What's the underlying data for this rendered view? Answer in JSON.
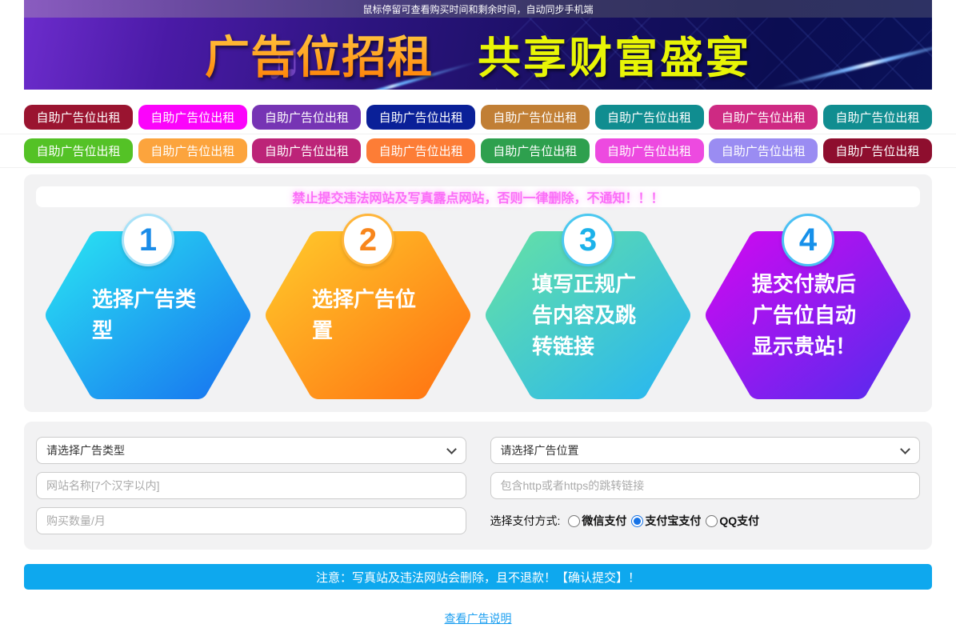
{
  "topbar": {
    "text": "鼠标停留可查看购买时间和剩余时间，自动同步手机端"
  },
  "banner": {
    "title": "广告位招租",
    "subtitle": "共享财富盛宴",
    "title_color_top": "#ffd24a",
    "title_color_bottom": "#ff7a00",
    "subtitle_color": "#e8f506"
  },
  "ad_buttons": {
    "label": "自助广告位出租",
    "row1_colors": [
      "#9a1430",
      "#fb04fb",
      "#7634b4",
      "#0a2098",
      "#c17f35",
      "#108d90",
      "#ce2a83",
      "#108d90"
    ],
    "row2_colors": [
      "#54c226",
      "#fca43d",
      "#bc2478",
      "#fd7d36",
      "#2ea04e",
      "#ed4ae0",
      "#9a8cf2",
      "#8e0e2e"
    ]
  },
  "notice": {
    "text": "禁止提交违法网站及写真露点网站，否则一律删除，不通知！！！",
    "color": "#fb6ef8"
  },
  "steps": [
    {
      "number": "1",
      "text": "选择广告类型",
      "gradient_from": "#29e0f2",
      "gradient_to": "#1876f0",
      "number_color": "#1a8ce8",
      "ring_color": "#a8e2f8"
    },
    {
      "number": "2",
      "text": "选择广告位置",
      "gradient_from": "#ffc62a",
      "gradient_to": "#ff7412",
      "number_color": "#f8861c",
      "ring_color": "#ffb53a"
    },
    {
      "number": "3",
      "text": "填写正规广告内容及跳转链接",
      "gradient_from": "#63dfa8",
      "gradient_to": "#29b7f0",
      "number_color": "#1cb2ea",
      "ring_color": "#4ac8f0"
    },
    {
      "number": "4",
      "text": "提交付款后广告位自动显示贵站！",
      "gradient_from": "#cc0af0",
      "gradient_to": "#5a2aee",
      "number_color": "#1690ea",
      "ring_color": "#4ac0f4"
    }
  ],
  "form": {
    "type_select": {
      "value": "请选择广告类型"
    },
    "position_select": {
      "value": "请选择广告位置"
    },
    "site_name": {
      "placeholder": "网站名称[7个汉字以内]"
    },
    "jump_link": {
      "placeholder": "包含http或者https的跳转链接"
    },
    "quantity": {
      "placeholder": "购买数量/月"
    },
    "payment": {
      "label": "选择支付方式:",
      "options": [
        {
          "label": "微信支付",
          "checked": false
        },
        {
          "label": "支付宝支付",
          "checked": true
        },
        {
          "label": "QQ支付",
          "checked": false
        }
      ]
    }
  },
  "submit": {
    "text": "注意：写真站及违法网站会删除，且不退款！【确认提交】！",
    "color": "#0ea8ee"
  },
  "footer_link": {
    "text": "查看广告说明",
    "color": "#1c9ff0"
  }
}
